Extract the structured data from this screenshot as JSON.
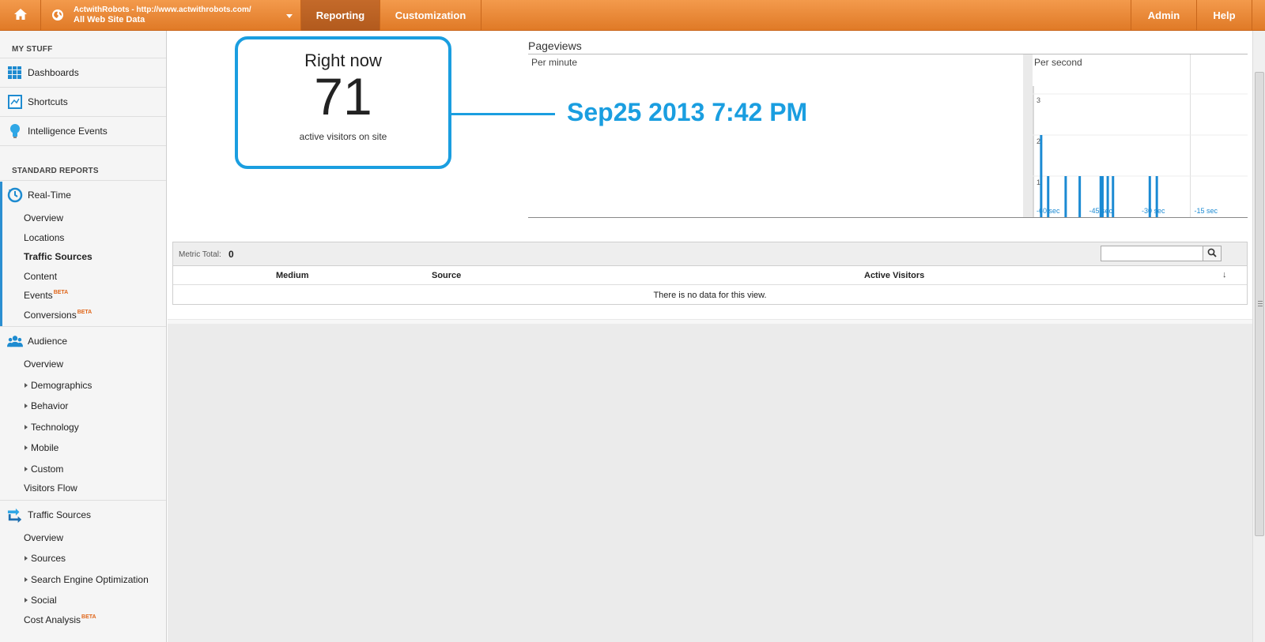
{
  "topbar": {
    "account_name": "ActwithRobots - http://www.actwithrobots.com/",
    "account_view": "All Web Site Data",
    "tabs": [
      {
        "label": "Reporting",
        "active": true
      },
      {
        "label": "Customization",
        "active": false
      }
    ],
    "admin_label": "Admin",
    "help_label": "Help",
    "color_brand": "#e8832f"
  },
  "sidebar": {
    "my_stuff_heading": "MY STUFF",
    "dashboards": "Dashboards",
    "shortcuts": "Shortcuts",
    "intelligence": "Intelligence Events",
    "standard_reports_heading": "STANDARD REPORTS",
    "realtime": {
      "label": "Real-Time",
      "items": [
        "Overview",
        "Locations",
        "Traffic Sources",
        "Content",
        "Events",
        "Conversions"
      ],
      "active_item": "Traffic Sources",
      "beta_label": "BETA"
    },
    "audience": {
      "label": "Audience",
      "items": [
        "Overview",
        "Demographics",
        "Behavior",
        "Technology",
        "Mobile",
        "Custom",
        "Visitors Flow"
      ]
    },
    "traffic_sources": {
      "label": "Traffic Sources",
      "items": [
        "Overview",
        "Sources",
        "Search Engine Optimization",
        "Social",
        "Cost Analysis"
      ]
    }
  },
  "realtime": {
    "right_now_title": "Right now",
    "active_visitors": "71",
    "active_visitors_label": "active visitors on site",
    "timestamp": "Sep25 2013 7:42 PM",
    "accent_color": "#1a9ee0"
  },
  "pageviews": {
    "title": "Pageviews",
    "per_minute_label": "Per minute",
    "per_second_label": "Per second"
  },
  "chart_data": {
    "type": "bar",
    "title": "Per second",
    "xlabel": "",
    "ylabel": "",
    "ylim": [
      0,
      3
    ],
    "y_ticks": [
      "1",
      "2",
      "3"
    ],
    "x_ticks": [
      "-60 sec",
      "-45 sec",
      "-30 sec",
      "-15 sec"
    ],
    "x_range": [
      -60,
      0
    ],
    "bars": [
      {
        "x": -58,
        "value": 2
      },
      {
        "x": -56,
        "value": 1
      },
      {
        "x": -51,
        "value": 1
      },
      {
        "x": -47,
        "value": 1
      },
      {
        "x": -41,
        "value": 1
      },
      {
        "x": -40.5,
        "value": 1
      },
      {
        "x": -39,
        "value": 1
      },
      {
        "x": -37.5,
        "value": 1
      },
      {
        "x": -27,
        "value": 1
      },
      {
        "x": -25,
        "value": 1
      }
    ],
    "bar_color": "#1b8ad3",
    "grid": true
  },
  "table": {
    "metric_total_label": "Metric Total:",
    "metric_total_value": "0",
    "columns": [
      "Medium",
      "Source",
      "Active Visitors"
    ],
    "sort_indicator": "↓",
    "empty_message": "There is no data for this view."
  }
}
